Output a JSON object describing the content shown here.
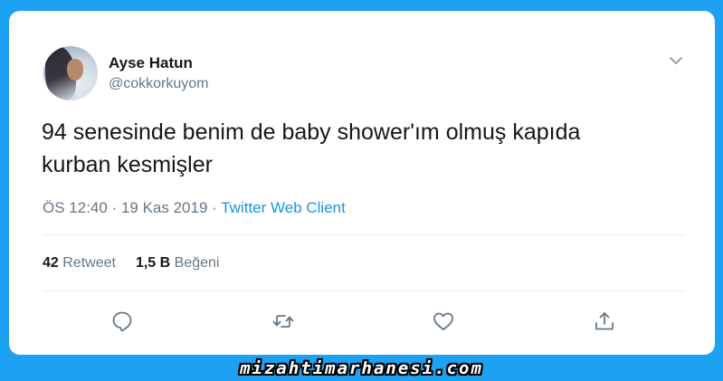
{
  "author": {
    "name": "Ayse Hatun",
    "handle": "@cokkorkuyom"
  },
  "tweet": {
    "lines": [
      "94 senesinde benim de baby shower'ım olmuş kapıda",
      "kurban kesmişler"
    ],
    "time": "ÖS 12:40",
    "sep1": " · ",
    "date": "19 Kas 2019",
    "sep2": " · ",
    "client": "Twitter Web Client"
  },
  "stats": {
    "retweet_count": "42",
    "retweet_label": "Retweet",
    "like_count": "1,5 B",
    "like_label": "Beğeni"
  },
  "icons": [
    "chevron-down-icon",
    "reply-icon",
    "retweet-icon",
    "like-icon",
    "share-icon"
  ],
  "colors": {
    "background": "#1da1f2",
    "link": "#1b95e0",
    "muted": "#657786",
    "text": "#14171a"
  },
  "watermark": "mizahtimarhanesi.com"
}
